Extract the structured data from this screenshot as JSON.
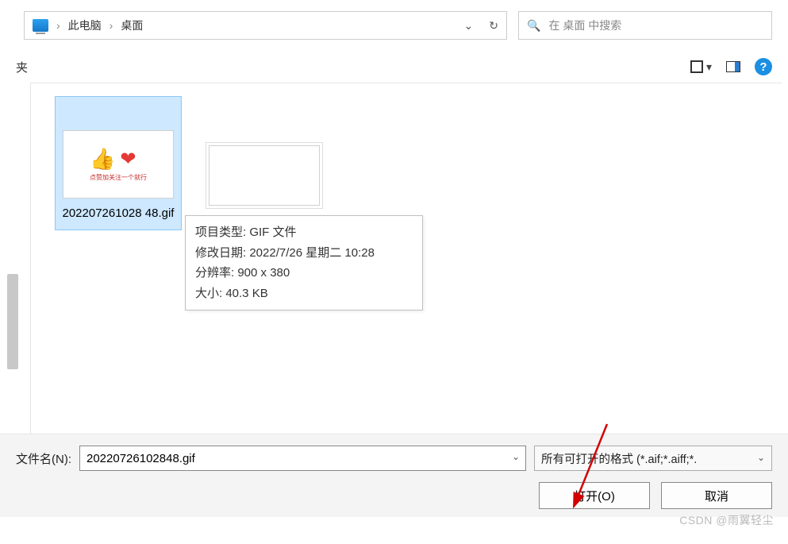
{
  "breadcrumb": {
    "item1": "此电脑",
    "item2": "桌面"
  },
  "search": {
    "placeholder": "在 桌面 中搜索"
  },
  "toolbar_left": "夹",
  "help_glyph": "?",
  "files": {
    "selected": {
      "name": "202207261028\n48.gif"
    },
    "tooltip": {
      "line1": "项目类型: GIF 文件",
      "line2": "修改日期: 2022/7/26 星期二 10:28",
      "line3": "分辨率: 900 x 380",
      "line4": "大小: 40.3 KB"
    },
    "thumb_caption": "点赞加关注一个就行"
  },
  "bottom": {
    "filename_label": "文件名(N):",
    "filename_value": "20220726102848.gif",
    "filter_label": "所有可打开的格式 (*.aif;*.aiff;*.",
    "open_label": "打开(O)",
    "cancel_label": "取消"
  },
  "watermark": "CSDN @雨翼轻尘"
}
